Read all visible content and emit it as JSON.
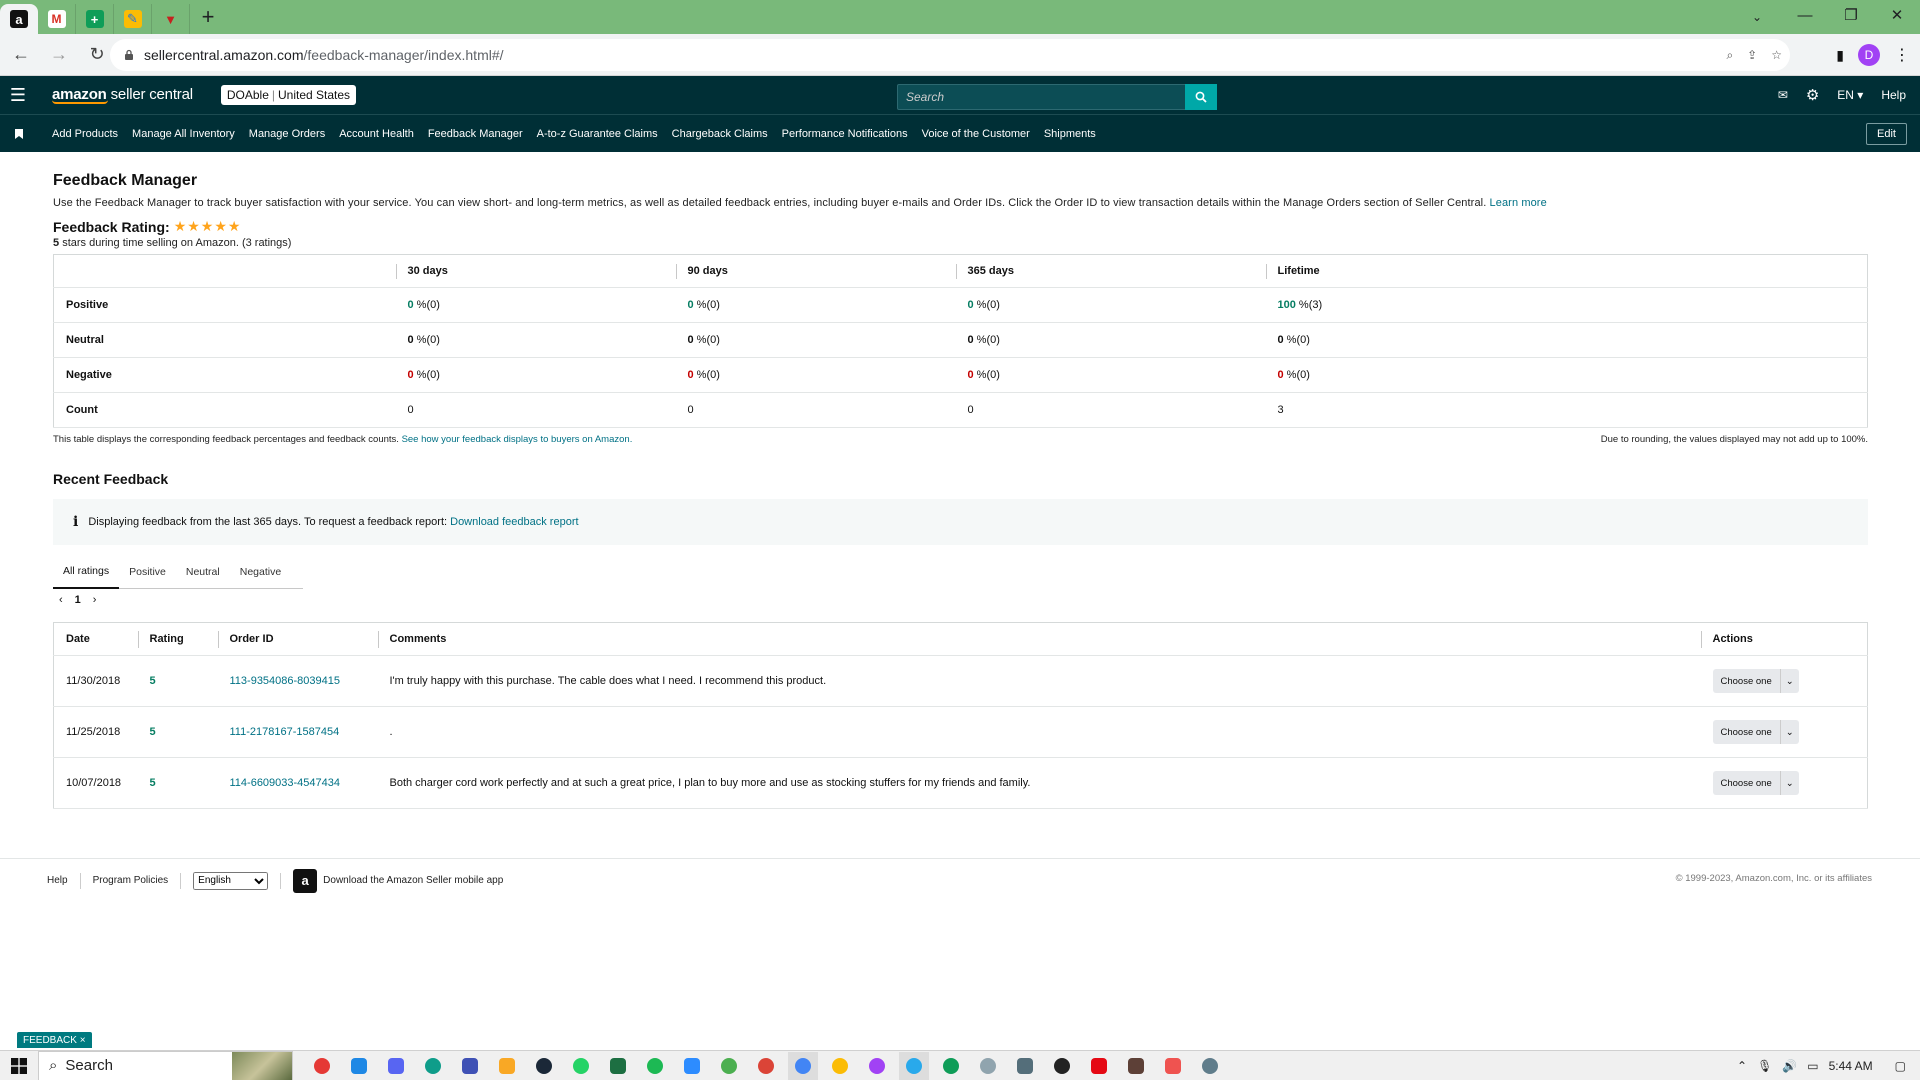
{
  "browser": {
    "url_host": "sellercentral.amazon.com",
    "url_path": "/feedback-manager/index.html#/",
    "profile_initial": "D",
    "tabs": [
      {
        "icon": "amazon-icon",
        "active": true
      },
      {
        "icon": "gmail-icon"
      },
      {
        "icon": "sheets-icon"
      },
      {
        "icon": "tasks-icon"
      },
      {
        "icon": "app-icon"
      }
    ]
  },
  "header": {
    "logo_amazon": "amazon",
    "logo_seller": "seller central",
    "store_name": "DOAble",
    "store_region": "United States",
    "search_placeholder": "Search",
    "lang": "EN",
    "help": "Help"
  },
  "nav": {
    "items": [
      "Add Products",
      "Manage All Inventory",
      "Manage Orders",
      "Account Health",
      "Feedback Manager",
      "A-to-z Guarantee Claims",
      "Chargeback Claims",
      "Performance Notifications",
      "Voice of the Customer",
      "Shipments"
    ],
    "edit": "Edit"
  },
  "page": {
    "title": "Feedback Manager",
    "description": "Use the Feedback Manager to track buyer satisfaction with your service. You can view short- and long-term metrics, as well as detailed feedback entries, including buyer e-mails and Order IDs. Click the Order ID to view transaction details within the Manage Orders section of Seller Central.",
    "learn_more": "Learn more",
    "rating_label": "Feedback Rating:",
    "rating_stars": 5,
    "rating_sub_value": "5",
    "rating_sub_text": "stars during time selling on Amazon. (3 ratings)"
  },
  "metrics": {
    "columns": [
      "30 days",
      "90 days",
      "365 days",
      "Lifetime"
    ],
    "rows": [
      {
        "label": "Positive",
        "cells": [
          {
            "v": "0",
            "r": " %(0)"
          },
          {
            "v": "0",
            "r": " %(0)"
          },
          {
            "v": "0",
            "r": " %(0)"
          },
          {
            "v": "100",
            "r": " %(3)"
          }
        ]
      },
      {
        "label": "Neutral",
        "cells": [
          {
            "v": "0",
            "r": " %(0)"
          },
          {
            "v": "0",
            "r": " %(0)"
          },
          {
            "v": "0",
            "r": " %(0)"
          },
          {
            "v": "0",
            "r": " %(0)"
          }
        ]
      },
      {
        "label": "Negative",
        "cells": [
          {
            "v": "0",
            "r": " %(0)"
          },
          {
            "v": "0",
            "r": " %(0)"
          },
          {
            "v": "0",
            "r": " %(0)"
          },
          {
            "v": "0",
            "r": " %(0)"
          }
        ]
      },
      {
        "label": "Count",
        "cells": [
          {
            "v": "0",
            "r": ""
          },
          {
            "v": "0",
            "r": ""
          },
          {
            "v": "0",
            "r": ""
          },
          {
            "v": "3",
            "r": ""
          }
        ]
      }
    ],
    "note_left": "This table displays the corresponding feedback percentages and feedback counts.",
    "note_link": "See how your feedback displays to buyers on Amazon.",
    "note_right": "Due to rounding, the values displayed may not add up to 100%."
  },
  "recent": {
    "title": "Recent Feedback",
    "info_text": "Displaying feedback from the last 365 days. To request a feedback report:",
    "info_link": "Download feedback report",
    "tabs": [
      "All ratings",
      "Positive",
      "Neutral",
      "Negative"
    ],
    "page": "1",
    "columns": {
      "date": "Date",
      "rating": "Rating",
      "order": "Order ID",
      "comments": "Comments",
      "actions": "Actions"
    },
    "rows": [
      {
        "date": "11/30/2018",
        "rating": "5",
        "order": "113-9354086-8039415",
        "comment": "I'm truly happy with this purchase. The cable does what I need. I recommend this product.",
        "action": "Choose one"
      },
      {
        "date": "11/25/2018",
        "rating": "5",
        "order": "111-2178167-1587454",
        "comment": ".",
        "action": "Choose one"
      },
      {
        "date": "10/07/2018",
        "rating": "5",
        "order": "114-6609033-4547434",
        "comment": "Both charger cord work perfectly and at such a great price, I plan to buy more and use as stocking stuffers for my friends and family.",
        "action": "Choose one"
      }
    ]
  },
  "footer": {
    "help": "Help",
    "policies": "Program Policies",
    "language": "English",
    "app": "Download the Amazon Seller mobile app",
    "copyright": "© 1999-2023, Amazon.com, Inc. or its affiliates"
  },
  "feedback_tag": "FEEDBACK",
  "taskbar": {
    "search": "Search",
    "time": "5:44 AM"
  },
  "colors": {
    "header_bg": "#002f36",
    "tab_strip": "#79b97a",
    "link": "#007185",
    "positive": "#067d62",
    "negative": "#c40000",
    "star": "#ffa41c"
  }
}
